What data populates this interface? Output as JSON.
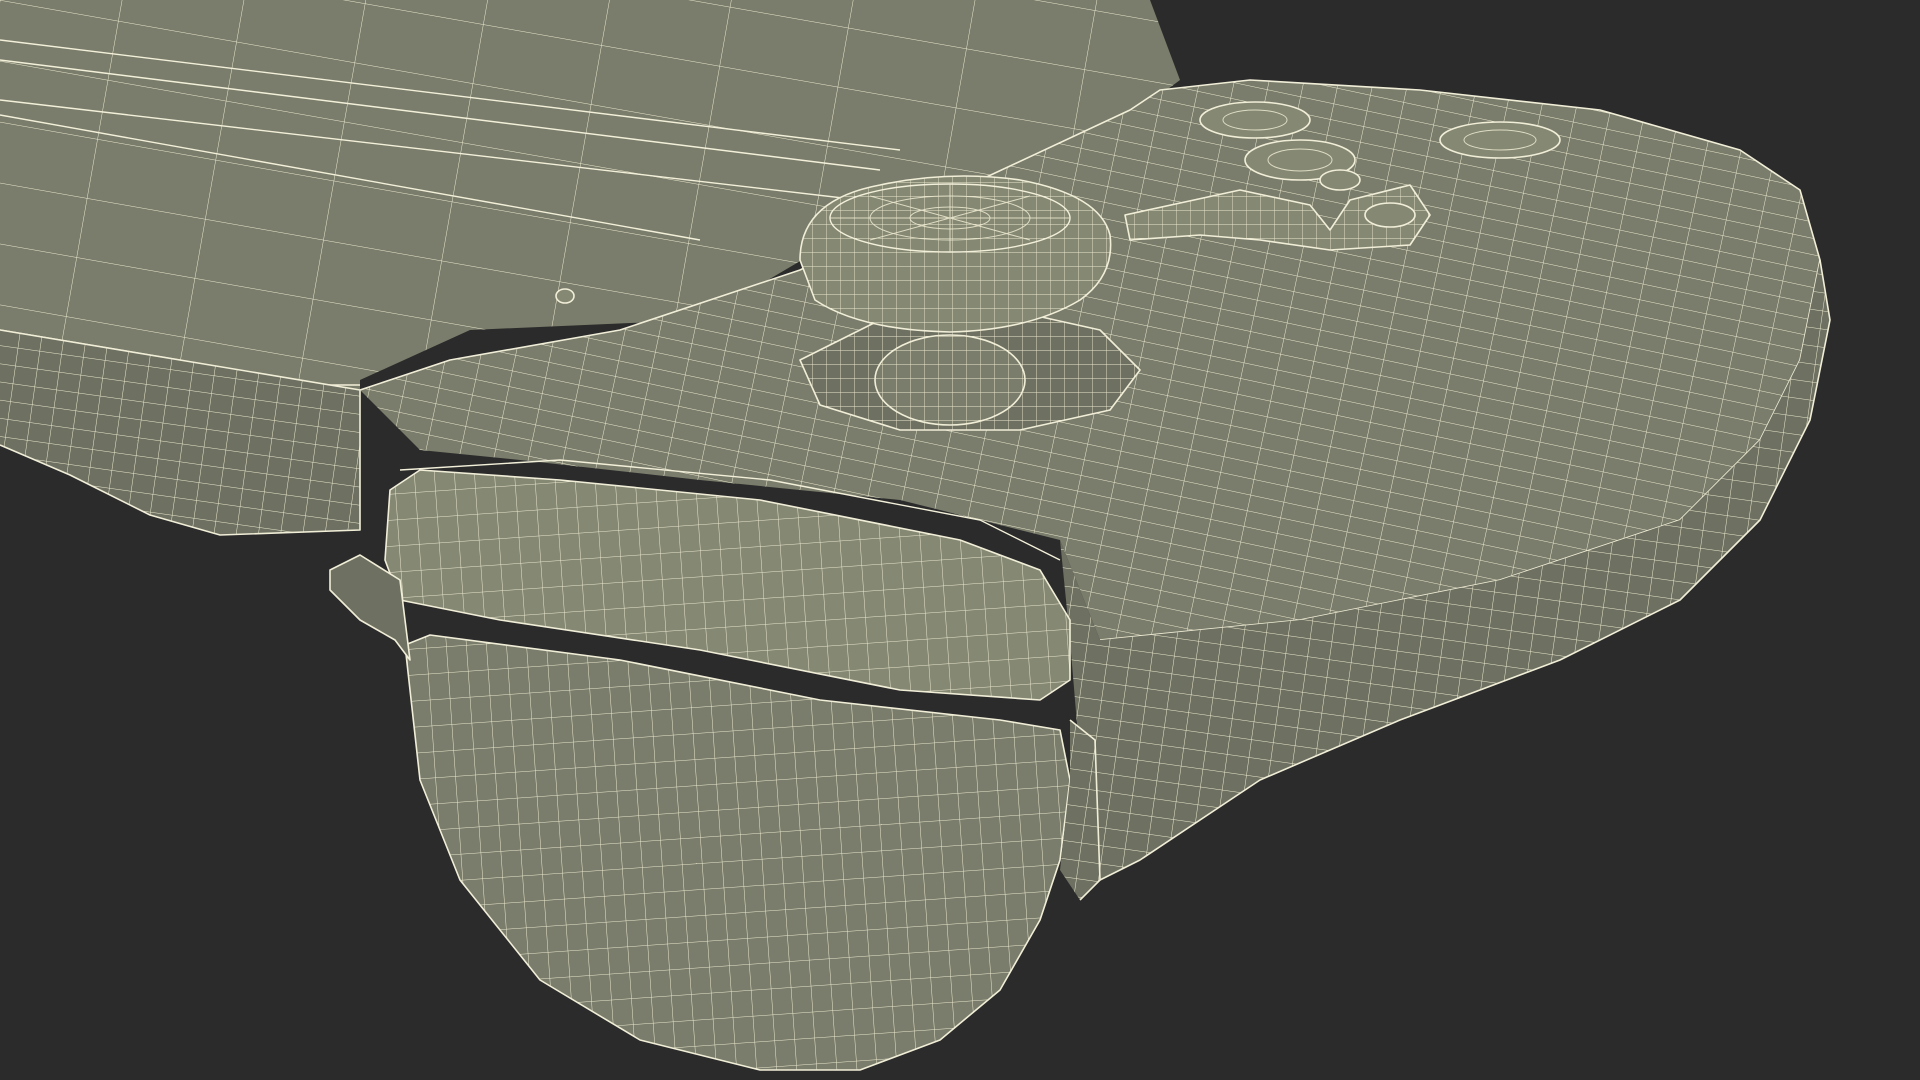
{
  "scene": {
    "subject": "wireframe-handheld-console-grip",
    "colors": {
      "background": "#2b2b2b",
      "surface": "#7a7d6b",
      "wireframe": "#f1eed8"
    }
  }
}
